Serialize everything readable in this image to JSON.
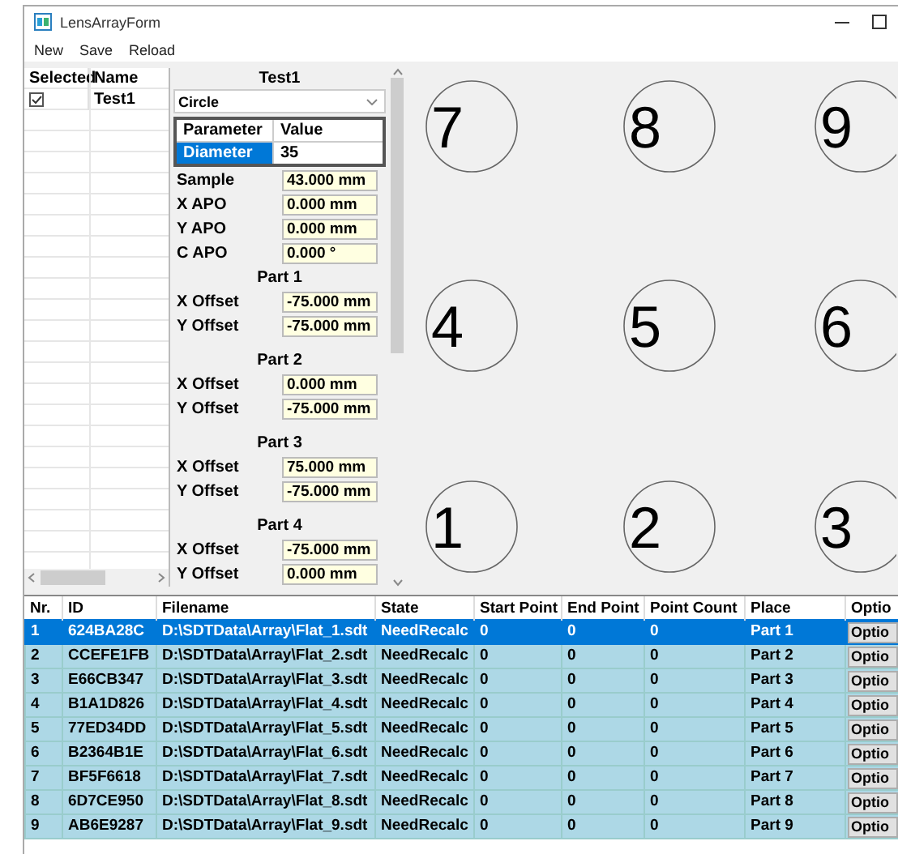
{
  "window": {
    "title": "LensArrayForm"
  },
  "menu": [
    "New",
    "Save",
    "Reload"
  ],
  "array_list": {
    "columns": [
      "Selected",
      "Name"
    ],
    "rows": [
      {
        "checked": true,
        "name": "Test1"
      }
    ]
  },
  "editor": {
    "title": "Test1",
    "shape": "Circle",
    "parameter_table": {
      "columns": [
        "Parameter",
        "Value"
      ],
      "rows": [
        {
          "parameter": "Diameter",
          "value": "35",
          "selected": true
        }
      ]
    },
    "fields": [
      {
        "kind": "field",
        "label": "Sample",
        "value": "43.000 mm"
      },
      {
        "kind": "field",
        "label": "X APO",
        "value": "0.000 mm"
      },
      {
        "kind": "field",
        "label": "Y APO",
        "value": "0.000 mm"
      },
      {
        "kind": "field",
        "label": "C APO",
        "value": "0.000 °"
      },
      {
        "kind": "heading",
        "label": "Part 1"
      },
      {
        "kind": "field",
        "label": "X Offset",
        "value": "-75.000 mm"
      },
      {
        "kind": "field",
        "label": "Y Offset",
        "value": "-75.000 mm"
      },
      {
        "kind": "heading",
        "label": "Part 2"
      },
      {
        "kind": "field",
        "label": "X Offset",
        "value": "0.000 mm"
      },
      {
        "kind": "field",
        "label": "Y Offset",
        "value": "-75.000 mm"
      },
      {
        "kind": "heading",
        "label": "Part 3"
      },
      {
        "kind": "field",
        "label": "X Offset",
        "value": "75.000 mm"
      },
      {
        "kind": "field",
        "label": "Y Offset",
        "value": "-75.000 mm"
      },
      {
        "kind": "heading",
        "label": "Part 4"
      },
      {
        "kind": "field",
        "label": "X Offset",
        "value": "-75.000 mm"
      },
      {
        "kind": "field",
        "label": "Y Offset",
        "value": "0.000 mm"
      }
    ]
  },
  "layout_canvas": {
    "circles": [
      "7",
      "8",
      "9",
      "4",
      "5",
      "6",
      "1",
      "2",
      "3"
    ]
  },
  "parts_table": {
    "columns": [
      "Nr.",
      "ID",
      "Filename",
      "State",
      "Start Point",
      "End Point",
      "Point Count",
      "Place",
      "Optio"
    ],
    "rows": [
      {
        "nr": "1",
        "id": "624BA28C",
        "filename": "D:\\SDTData\\Array\\Flat_1.sdt",
        "state": "NeedRecalc",
        "start_point": "0",
        "end_point": "0",
        "point_count": "0",
        "place": "Part 1",
        "option": "Optio",
        "selected": true
      },
      {
        "nr": "2",
        "id": "CCEFE1FB",
        "filename": "D:\\SDTData\\Array\\Flat_2.sdt",
        "state": "NeedRecalc",
        "start_point": "0",
        "end_point": "0",
        "point_count": "0",
        "place": "Part 2",
        "option": "Optio",
        "selected": false
      },
      {
        "nr": "3",
        "id": "E66CB347",
        "filename": "D:\\SDTData\\Array\\Flat_3.sdt",
        "state": "NeedRecalc",
        "start_point": "0",
        "end_point": "0",
        "point_count": "0",
        "place": "Part 3",
        "option": "Optio",
        "selected": false
      },
      {
        "nr": "4",
        "id": "B1A1D826",
        "filename": "D:\\SDTData\\Array\\Flat_4.sdt",
        "state": "NeedRecalc",
        "start_point": "0",
        "end_point": "0",
        "point_count": "0",
        "place": "Part 4",
        "option": "Optio",
        "selected": false
      },
      {
        "nr": "5",
        "id": "77ED34DD",
        "filename": "D:\\SDTData\\Array\\Flat_5.sdt",
        "state": "NeedRecalc",
        "start_point": "0",
        "end_point": "0",
        "point_count": "0",
        "place": "Part 5",
        "option": "Optio",
        "selected": false
      },
      {
        "nr": "6",
        "id": "B2364B1E",
        "filename": "D:\\SDTData\\Array\\Flat_6.sdt",
        "state": "NeedRecalc",
        "start_point": "0",
        "end_point": "0",
        "point_count": "0",
        "place": "Part 6",
        "option": "Optio",
        "selected": false
      },
      {
        "nr": "7",
        "id": "BF5F6618",
        "filename": "D:\\SDTData\\Array\\Flat_7.sdt",
        "state": "NeedRecalc",
        "start_point": "0",
        "end_point": "0",
        "point_count": "0",
        "place": "Part 7",
        "option": "Optio",
        "selected": false
      },
      {
        "nr": "8",
        "id": "6D7CE950",
        "filename": "D:\\SDTData\\Array\\Flat_8.sdt",
        "state": "NeedRecalc",
        "start_point": "0",
        "end_point": "0",
        "point_count": "0",
        "place": "Part 8",
        "option": "Optio",
        "selected": false
      },
      {
        "nr": "9",
        "id": "AB6E9287",
        "filename": "D:\\SDTData\\Array\\Flat_9.sdt",
        "state": "NeedRecalc",
        "start_point": "0",
        "end_point": "0",
        "point_count": "0",
        "place": "Part 9",
        "option": "Optio",
        "selected": false
      }
    ]
  }
}
